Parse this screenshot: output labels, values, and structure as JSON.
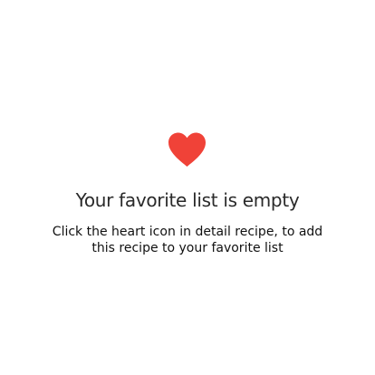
{
  "empty_state": {
    "icon": "heart-icon",
    "icon_color": "#f04238",
    "title": "Your favorite list is empty",
    "description": "Click the heart icon in detail recipe, to add this recipe to your favorite list"
  },
  "colors": {
    "background": "#ffffff",
    "title": "#2a2a2a",
    "description": "#111111"
  }
}
